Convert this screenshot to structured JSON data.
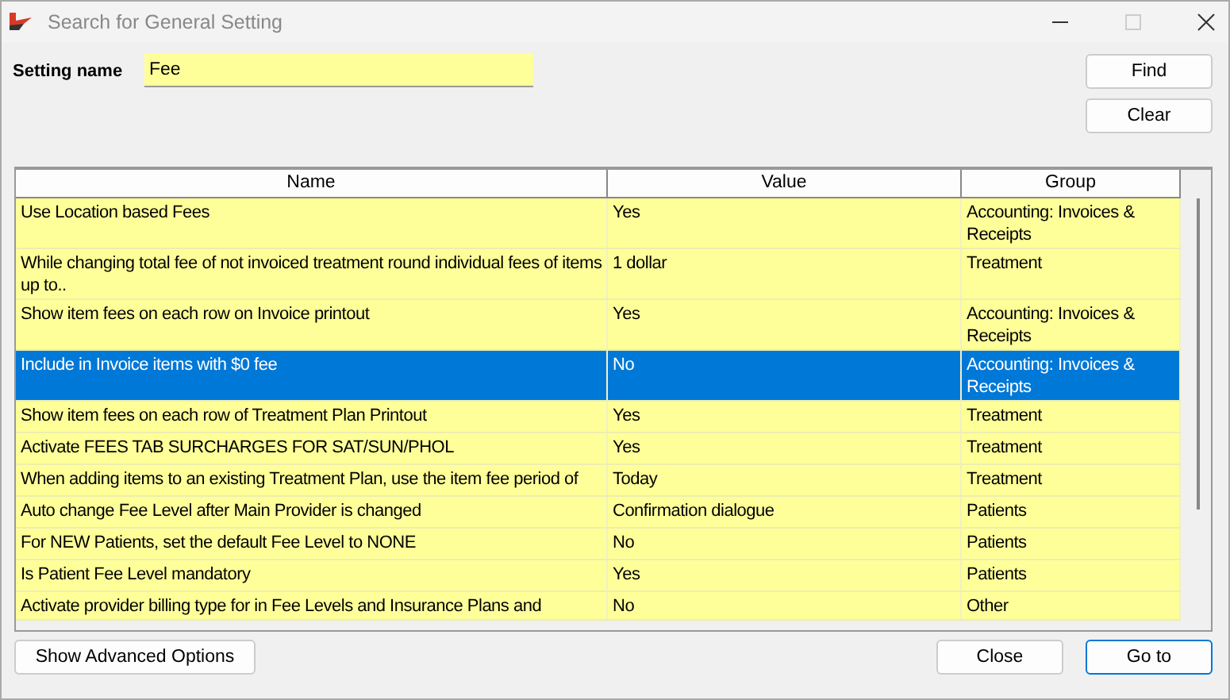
{
  "window": {
    "title": "Search for General Setting"
  },
  "search": {
    "label": "Setting name",
    "value": "Fee"
  },
  "side_buttons": [
    "Find",
    "Clear"
  ],
  "table": {
    "columns": [
      "Name",
      "Value",
      "Group"
    ],
    "rows": [
      {
        "name": "Use Location based Fees",
        "value": "Yes",
        "group": "Accounting: Invoices & Receipts",
        "selected": false
      },
      {
        "name": "While changing total fee of not invoiced treatment round individual fees of items up to..",
        "value": "1 dollar",
        "group": "Treatment",
        "selected": false
      },
      {
        "name": "Show item fees on each row on Invoice printout",
        "value": "Yes",
        "group": "Accounting: Invoices & Receipts",
        "selected": false
      },
      {
        "name": "Include in Invoice items with $0 fee",
        "value": "No",
        "group": "Accounting: Invoices & Receipts",
        "selected": true
      },
      {
        "name": "Show item fees on each row of Treatment Plan Printout",
        "value": "Yes",
        "group": "Treatment",
        "selected": false
      },
      {
        "name": "Activate FEES TAB SURCHARGES FOR SAT/SUN/PHOL",
        "value": "Yes",
        "group": "Treatment",
        "selected": false
      },
      {
        "name": "When adding items to an existing Treatment Plan, use the item fee period of",
        "value": "Today",
        "group": "Treatment",
        "selected": false
      },
      {
        "name": "Auto change Fee Level after Main Provider is changed",
        "value": "Confirmation dialogue",
        "group": "Patients",
        "selected": false
      },
      {
        "name": "For NEW Patients, set the default Fee Level to NONE",
        "value": "No",
        "group": "Patients",
        "selected": false
      },
      {
        "name": "Is Patient Fee Level mandatory",
        "value": "Yes",
        "group": "Patients",
        "selected": false
      },
      {
        "name": "Activate provider billing type for in Fee Levels and Insurance Plans and",
        "value": "No",
        "group": "Other",
        "selected": false
      }
    ]
  },
  "footer": {
    "left_button": "Show Advanced Options",
    "close_button": "Close",
    "goto_button": "Go to"
  }
}
